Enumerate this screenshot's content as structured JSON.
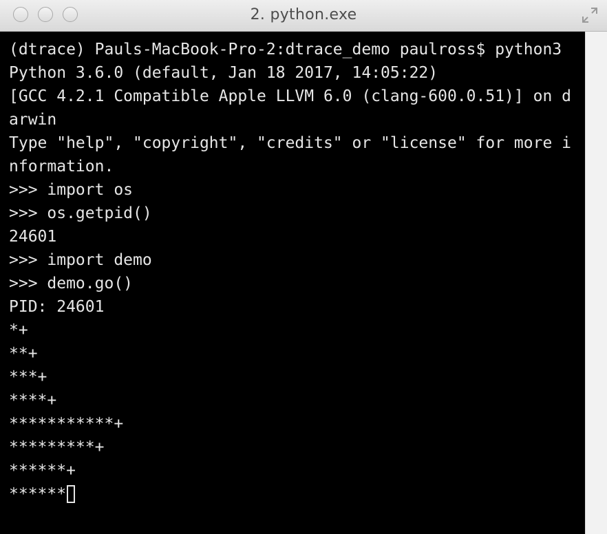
{
  "window": {
    "title": "2. python.exe"
  },
  "terminal": {
    "lines": [
      "(dtrace) Pauls-MacBook-Pro-2:dtrace_demo paulross$ python3",
      "Python 3.6.0 (default, Jan 18 2017, 14:05:22)",
      "[GCC 4.2.1 Compatible Apple LLVM 6.0 (clang-600.0.51)] on d",
      "arwin",
      "Type \"help\", \"copyright\", \"credits\" or \"license\" for more i",
      "nformation.",
      ">>> import os",
      ">>> os.getpid()",
      "24601",
      ">>> import demo",
      ">>> demo.go()",
      "PID: 24601",
      "*+",
      "**+",
      "***+",
      "****+",
      "***********+",
      "*********+",
      "******+",
      "******"
    ]
  },
  "colors": {
    "terminal_bg": "#000000",
    "terminal_fg": "#e6e6e6",
    "titlebar_bg": "#e3e3e3"
  },
  "icons": {
    "close": "close-icon",
    "minimize": "minimize-icon",
    "zoom": "zoom-icon",
    "fullscreen": "fullscreen-arrows-icon"
  }
}
